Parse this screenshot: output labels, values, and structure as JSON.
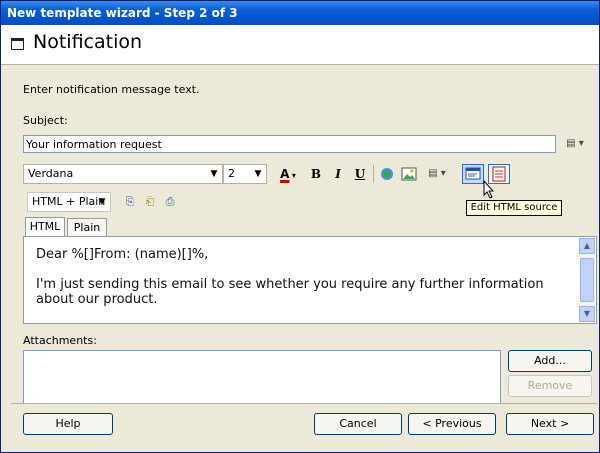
{
  "window": {
    "title": "New template wizard - Step 2 of 3"
  },
  "header": {
    "title": "Notification",
    "icon": "document-icon"
  },
  "form": {
    "instruction": "Enter notification message text.",
    "subject_label": "Subject:",
    "subject_value": "Your information request",
    "subject_menu_icon": "field-menu-icon"
  },
  "toolbar": {
    "font": "Verdana",
    "size": "2",
    "color_glyph": "A",
    "bold": "B",
    "italic": "I",
    "underline": "U",
    "format": "HTML + Plain",
    "accent_color": "#cc0000",
    "icons": [
      "font-color-icon",
      "bold-icon",
      "italic-icon",
      "underline-icon",
      "link-icon",
      "image-icon",
      "insert-menu-icon",
      "edit-html-source-icon",
      "notepad-icon",
      "copy-icon",
      "paste-icon",
      "paste-special-icon"
    ]
  },
  "tooltip": "Edit HTML source",
  "tabs": [
    {
      "label": "HTML"
    },
    {
      "label": "Plain"
    }
  ],
  "editor": {
    "line1": "Dear %[]From: (name)[]%,",
    "line2": "I'm just sending this email to see whether you require any further information about our product."
  },
  "attachments": {
    "label": "Attachments:",
    "add": "Add...",
    "remove": "Remove"
  },
  "buttons": {
    "help": "Help",
    "cancel": "Cancel",
    "previous": "< Previous",
    "next": "Next >"
  }
}
